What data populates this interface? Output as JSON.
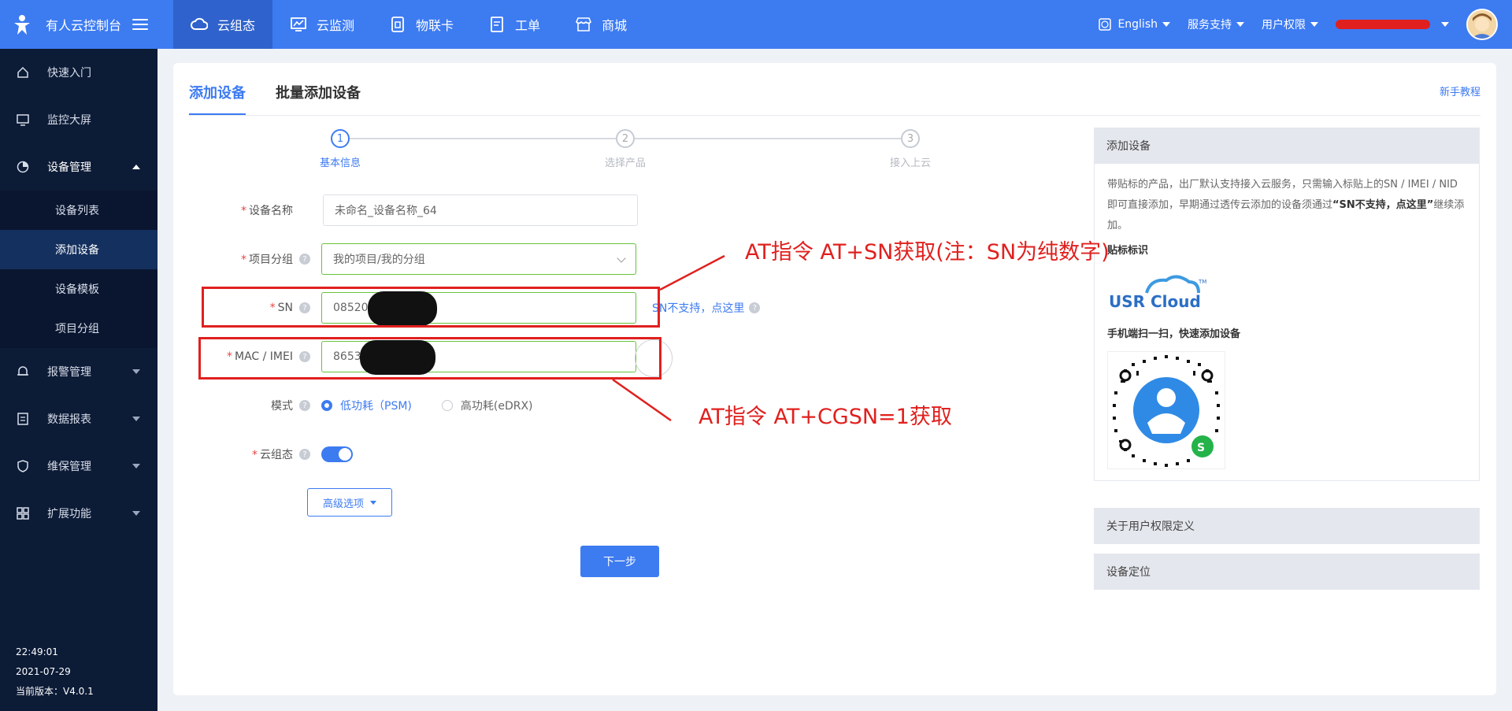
{
  "brand": {
    "title": "有人云控制台"
  },
  "top_nav": [
    {
      "label": "云组态",
      "icon": "cloud-icon",
      "active": true
    },
    {
      "label": "云监测",
      "icon": "monitor-chart-icon",
      "active": false
    },
    {
      "label": "物联卡",
      "icon": "sim-card-icon",
      "active": false
    },
    {
      "label": "工单",
      "icon": "ticket-icon",
      "active": false
    },
    {
      "label": "商城",
      "icon": "store-icon",
      "active": false
    }
  ],
  "right_nav": {
    "language": "English",
    "support": "服务支持",
    "permissions": "用户权限"
  },
  "sidebar": {
    "items": [
      {
        "label": "快速入门",
        "icon": "home-icon"
      },
      {
        "label": "监控大屏",
        "icon": "screen-icon"
      },
      {
        "label": "设备管理",
        "icon": "device-manage-icon"
      },
      {
        "label": "报警管理",
        "icon": "bell-icon"
      },
      {
        "label": "数据报表",
        "icon": "report-icon"
      },
      {
        "label": "维保管理",
        "icon": "shield-icon"
      },
      {
        "label": "扩展功能",
        "icon": "apps-icon"
      }
    ],
    "sub_items": [
      "设备列表",
      "添加设备",
      "设备模板",
      "项目分组"
    ],
    "footer": {
      "time": "22:49:01",
      "date": "2021-07-29",
      "version": "当前版本：V4.0.1"
    }
  },
  "tabs": [
    "添加设备",
    "批量添加设备"
  ],
  "help_link": "新手教程",
  "steps": [
    {
      "num": "1",
      "label": "基本信息"
    },
    {
      "num": "2",
      "label": "选择产品"
    },
    {
      "num": "3",
      "label": "接入上云"
    }
  ],
  "form": {
    "device_name": {
      "label": "设备名称",
      "value": "未命名_设备名称_64"
    },
    "project_group": {
      "label": "项目分组",
      "value": "我的项目/我的分组"
    },
    "sn": {
      "label": "SN",
      "value": "08520",
      "link": "SN不支持，点这里"
    },
    "mac": {
      "label": "MAC / IMEI",
      "value": "8653"
    },
    "mode": {
      "label": "模式",
      "option_psm": "低功耗（PSM)",
      "option_edrx": "高功耗(eDRX)"
    },
    "cloud": {
      "label": "云组态"
    },
    "advanced": "高级选项",
    "next": "下一步"
  },
  "panel": {
    "add_device": {
      "title": "添加设备",
      "text1": "带贴标的产品，出厂默认支持接入云服务，只需输入标贴上的SN / IMEI / NID 即可直接添加，早期通过透传云添加的设备须通过",
      "text_bold": "“SN不支持，点这里”",
      "text2": "继续添加。",
      "label_sticker": "贴标标识",
      "logo_text": "USR Cloud",
      "scan_hint": "手机端扫一扫，快速添加设备"
    },
    "permissions_def": "关于用户权限定义",
    "device_location": "设备定位"
  },
  "annotations": {
    "sn_note": "AT指令 AT+SN获取(注：SN为纯数字)",
    "imei_note": "AT指令 AT+CGSN=1获取"
  },
  "colors": {
    "primary": "#3d7bf1",
    "sidebar": "#0c1b36",
    "annotation": "#e0201e"
  }
}
